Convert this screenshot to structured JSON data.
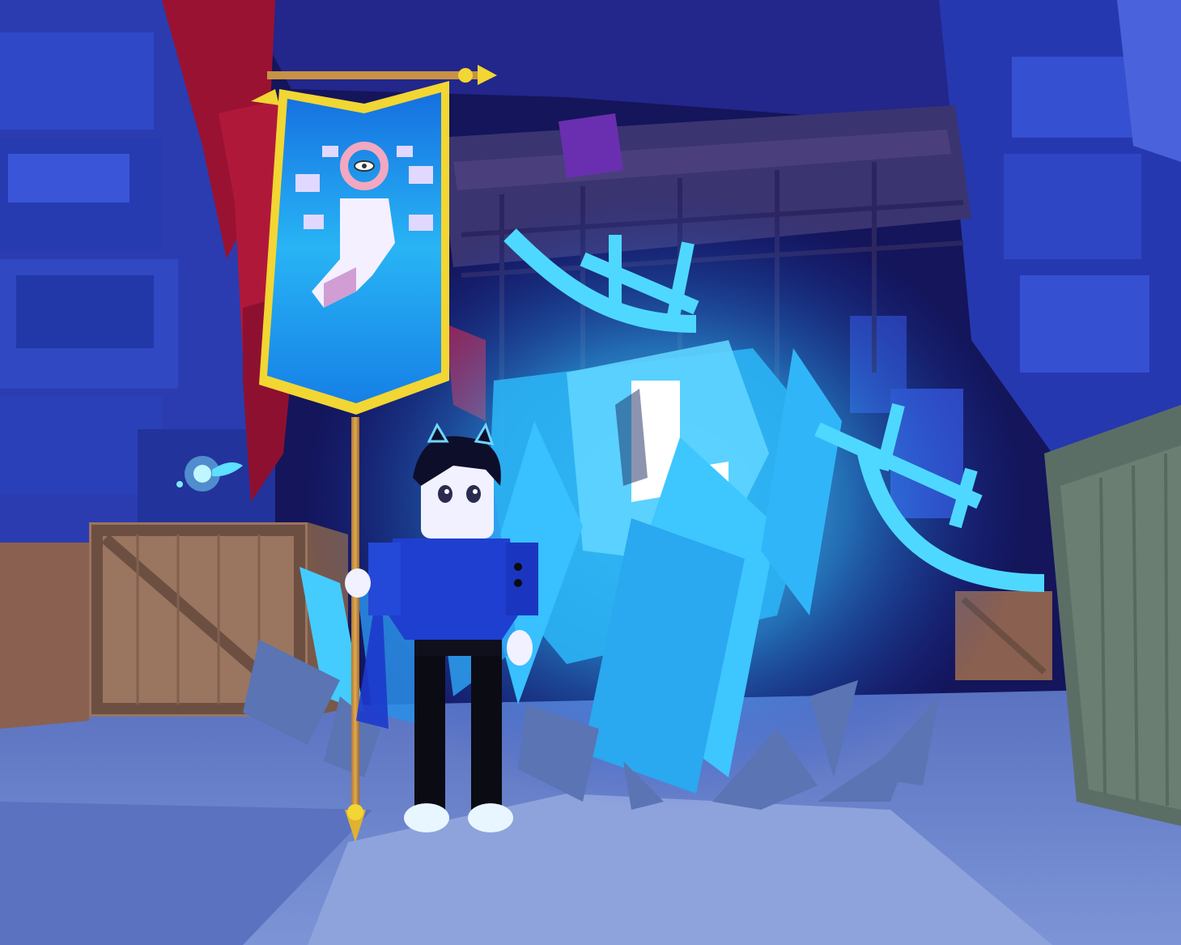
{
  "scene": {
    "palette": {
      "sky_dark": "#16175a",
      "wall_blue": "#2a3fb8",
      "wall_deep": "#1c2a8c",
      "floor": "#6f88c8",
      "floor_light": "#8aa0d8",
      "crate_wood": "#9a7560",
      "crate_dark": "#6d4f42",
      "crate_green": "#6a7f72",
      "red_vines": "#b0183a",
      "banner_blue": "#1c8fe8",
      "banner_trim": "#f2d633",
      "aura_cyan": "#3fd0ff",
      "aura_light": "#b9f2ff",
      "hoodie": "#1f3fd0",
      "pants": "#0b0b14"
    },
    "icons": {
      "banner_emblem": "raised-fist-eye-halo-icon",
      "fairy_companion": "fairy-icon"
    }
  }
}
